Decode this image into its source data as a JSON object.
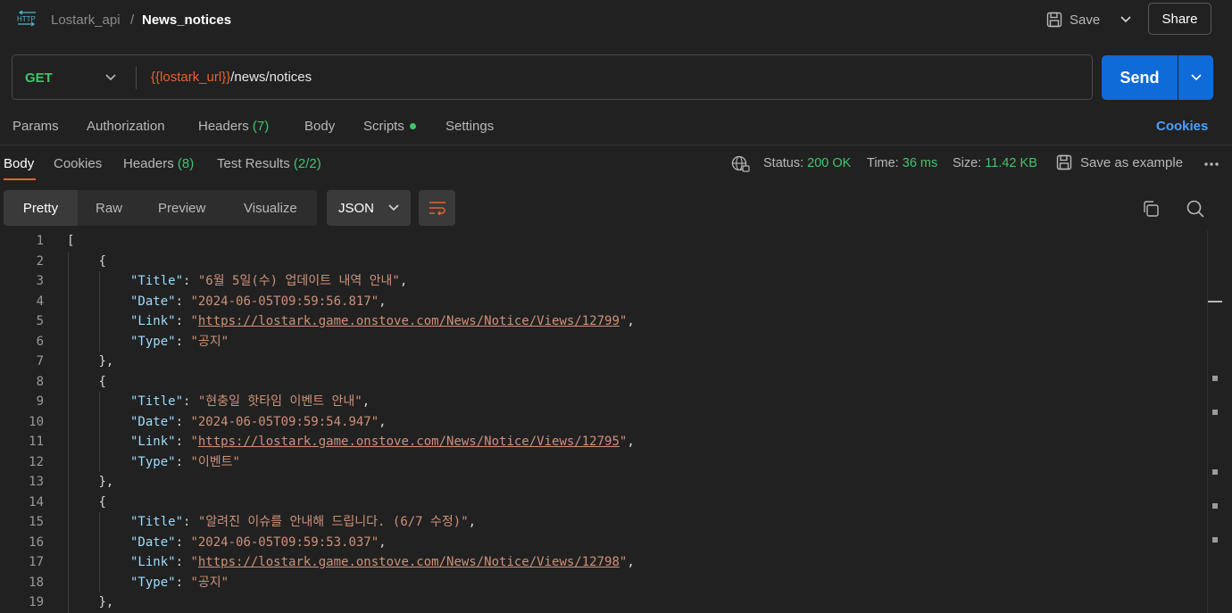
{
  "header": {
    "collection": "Lostark_api",
    "separator": "/",
    "request_name": "News_notices",
    "save_label": "Save",
    "share_label": "Share"
  },
  "request": {
    "method": "GET",
    "url_variable": "{{lostark_url}}",
    "url_path": "/news/notices",
    "send_label": "Send"
  },
  "request_tabs": {
    "params": "Params",
    "authorization": "Authorization",
    "headers": "Headers",
    "headers_count": "(7)",
    "body": "Body",
    "scripts": "Scripts",
    "settings": "Settings",
    "cookies": "Cookies"
  },
  "response_tabs": {
    "body": "Body",
    "cookies": "Cookies",
    "headers": "Headers",
    "headers_count": "(8)",
    "tests": "Test Results",
    "tests_count": "(2/2)"
  },
  "status": {
    "status_label": "Status:",
    "status_value": "200 OK",
    "time_label": "Time:",
    "time_value": "36 ms",
    "size_label": "Size:",
    "size_value": "11.42 KB",
    "save_example": "Save as example"
  },
  "viewer": {
    "pretty": "Pretty",
    "raw": "Raw",
    "preview": "Preview",
    "visualize": "Visualize",
    "format": "JSON"
  },
  "code_lines": [
    {
      "n": "1",
      "indent": 0,
      "text": "["
    },
    {
      "n": "2",
      "indent": 1,
      "text": "{"
    },
    {
      "n": "3",
      "indent": 2,
      "key": "\"Title\"",
      "value": "\"6월 5일(수) 업데이트 내역 안내\"",
      "comma": ","
    },
    {
      "n": "4",
      "indent": 2,
      "key": "\"Date\"",
      "value": "\"2024-06-05T09:59:56.817\"",
      "comma": ","
    },
    {
      "n": "5",
      "indent": 2,
      "key": "\"Link\"",
      "url": "https://lostark.game.onstove.com/News/Notice/Views/12799",
      "comma": ","
    },
    {
      "n": "6",
      "indent": 2,
      "key": "\"Type\"",
      "value": "\"공지\"",
      "comma": ""
    },
    {
      "n": "7",
      "indent": 1,
      "text": "},"
    },
    {
      "n": "8",
      "indent": 1,
      "text": "{"
    },
    {
      "n": "9",
      "indent": 2,
      "key": "\"Title\"",
      "value": "\"현충일 핫타임 이벤트 안내\"",
      "comma": ","
    },
    {
      "n": "10",
      "indent": 2,
      "key": "\"Date\"",
      "value": "\"2024-06-05T09:59:54.947\"",
      "comma": ","
    },
    {
      "n": "11",
      "indent": 2,
      "key": "\"Link\"",
      "url": "https://lostark.game.onstove.com/News/Notice/Views/12795",
      "comma": ","
    },
    {
      "n": "12",
      "indent": 2,
      "key": "\"Type\"",
      "value": "\"이벤트\"",
      "comma": ""
    },
    {
      "n": "13",
      "indent": 1,
      "text": "},"
    },
    {
      "n": "14",
      "indent": 1,
      "text": "{"
    },
    {
      "n": "15",
      "indent": 2,
      "key": "\"Title\"",
      "value": "\"알려진 이슈를 안내해 드립니다. (6/7 수정)\"",
      "comma": ","
    },
    {
      "n": "16",
      "indent": 2,
      "key": "\"Date\"",
      "value": "\"2024-06-05T09:59:53.037\"",
      "comma": ","
    },
    {
      "n": "17",
      "indent": 2,
      "key": "\"Link\"",
      "url": "https://lostark.game.onstove.com/News/Notice/Views/12798",
      "comma": ","
    },
    {
      "n": "18",
      "indent": 2,
      "key": "\"Type\"",
      "value": "\"공지\"",
      "comma": ""
    },
    {
      "n": "19",
      "indent": 1,
      "text": "},"
    }
  ],
  "colors": {
    "accent": "#e8622c",
    "send": "#0f6bd8",
    "success": "#3fc56b",
    "link": "#4aa0ff"
  }
}
